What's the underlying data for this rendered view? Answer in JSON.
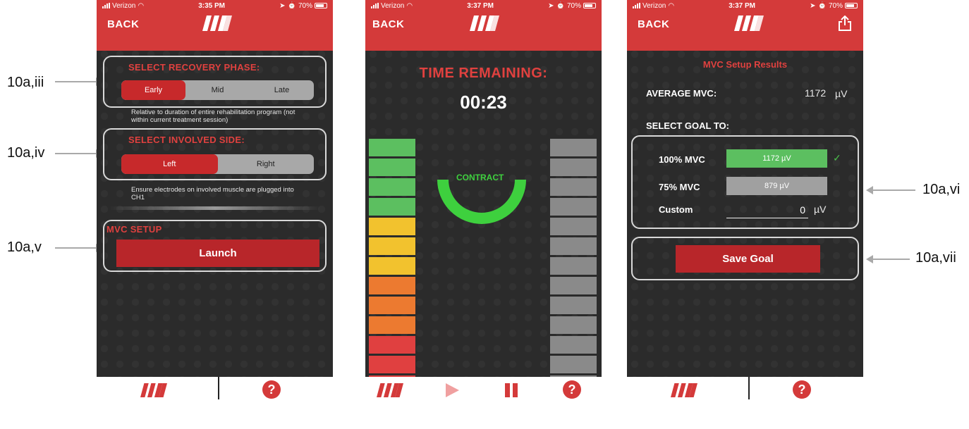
{
  "status": {
    "carrier": "Verizon",
    "battery": "70%",
    "time1": "3:35 PM",
    "time2": "3:37 PM",
    "time3": "3:37 PM"
  },
  "nav": {
    "back_label": "BACK"
  },
  "colors": {
    "brand_red": "#d43a3a",
    "accent_red": "#c7292b",
    "green": "#5cbf60",
    "gray": "#8a8a8a"
  },
  "icons": {
    "logo": "mm-logo",
    "share": "share-icon",
    "help": "question-circle-icon",
    "play": "play-icon",
    "pause": "pause-icon"
  },
  "panel1": {
    "recovery_title": "SELECT RECOVERY PHASE:",
    "recovery_options": [
      "Early",
      "Mid",
      "Late"
    ],
    "recovery_selected": "Early",
    "recovery_note": "Relative to duration of entire rehabilitation program (not within current treatment session)",
    "side_title": "SELECT INVOLVED SIDE:",
    "side_options": [
      "Left",
      "Right"
    ],
    "side_selected": "Left",
    "side_note": "Ensure electrodes on involved muscle are plugged into CH1",
    "mvc_title": "MVC SETUP",
    "launch_label": "Launch"
  },
  "panel2": {
    "time_remaining_label": "TIME REMAINING:",
    "timer": "00:23",
    "contract_label": "CONTRACT",
    "gauge_fraction": 0.5,
    "left_meter_levels": 13,
    "right_meter_levels": 13
  },
  "panel3": {
    "title": "MVC Setup Results",
    "average_label": "AVERAGE MVC:",
    "average_value": "1172",
    "average_unit": "µV",
    "select_goal_label": "SELECT GOAL TO:",
    "goal_100_label": "100% MVC",
    "goal_100_value": "1172 µV",
    "goal_75_label": "75% MVC",
    "goal_75_value": "879 µV",
    "custom_label": "Custom",
    "custom_value": "0",
    "custom_unit": "µV",
    "selected_goal": "100% MVC",
    "save_label": "Save Goal"
  },
  "annotations": {
    "a_iii": "10a,iii",
    "a_iv": "10a,iv",
    "a_v": "10a,v",
    "a_vi": "10a,vi",
    "a_vii": "10a,vii"
  }
}
